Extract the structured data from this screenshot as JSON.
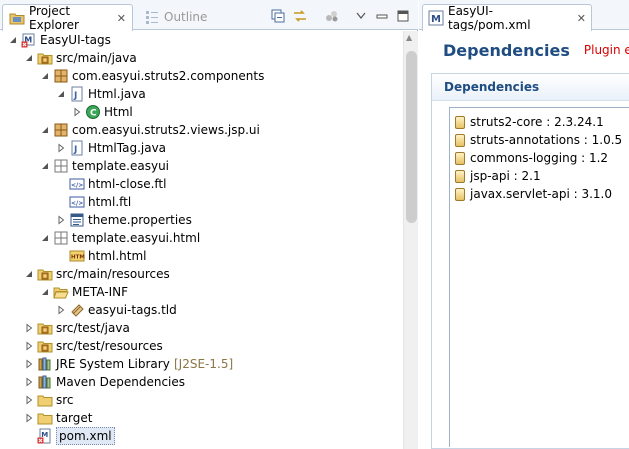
{
  "left_view": {
    "tabs": [
      {
        "label": "Project Explorer",
        "active": true,
        "close": "✕"
      },
      {
        "label": "Outline",
        "active": false
      }
    ],
    "tree": [
      {
        "label": "EasyUI-tags",
        "icon": "maven-project-error-icon",
        "twisty": "open",
        "depth": 0
      },
      {
        "label": "src/main/java",
        "icon": "source-folder-icon",
        "twisty": "open",
        "depth": 1
      },
      {
        "label": "com.easyui.struts2.components",
        "icon": "package-icon",
        "twisty": "open",
        "depth": 2
      },
      {
        "label": "Html.java",
        "icon": "java-file-icon",
        "twisty": "open",
        "depth": 3
      },
      {
        "label": "Html",
        "icon": "java-class-icon",
        "twisty": "closed",
        "depth": 4
      },
      {
        "label": "com.easyui.struts2.views.jsp.ui",
        "icon": "package-icon",
        "twisty": "open",
        "depth": 2
      },
      {
        "label": "HtmlTag.java",
        "icon": "java-file-icon",
        "twisty": "closed",
        "depth": 3
      },
      {
        "label": "template.easyui",
        "icon": "empty-package-icon",
        "twisty": "open",
        "depth": 2
      },
      {
        "label": "html-close.ftl",
        "icon": "ftl-file-icon",
        "twisty": "none",
        "depth": 3
      },
      {
        "label": "html.ftl",
        "icon": "ftl-file-icon",
        "twisty": "none",
        "depth": 3
      },
      {
        "label": "theme.properties",
        "icon": "properties-file-icon",
        "twisty": "closed",
        "depth": 3
      },
      {
        "label": "template.easyui.html",
        "icon": "empty-package-icon",
        "twisty": "open",
        "depth": 2
      },
      {
        "label": "html.html",
        "icon": "html-file-icon",
        "twisty": "none",
        "depth": 3
      },
      {
        "label": "src/main/resources",
        "icon": "source-folder-icon",
        "twisty": "open",
        "depth": 1
      },
      {
        "label": "META-INF",
        "icon": "folder-open-icon",
        "twisty": "open",
        "depth": 2
      },
      {
        "label": "easyui-tags.tld",
        "icon": "tld-file-icon",
        "twisty": "closed",
        "depth": 3
      },
      {
        "label": "src/test/java",
        "icon": "source-folder-icon",
        "twisty": "closed",
        "depth": 1
      },
      {
        "label": "src/test/resources",
        "icon": "source-folder-icon",
        "twisty": "closed",
        "depth": 1
      },
      {
        "label": "JRE System Library",
        "decoration": "[J2SE-1.5]",
        "icon": "library-icon",
        "twisty": "closed",
        "depth": 1
      },
      {
        "label": "Maven Dependencies",
        "icon": "library-icon",
        "twisty": "closed",
        "depth": 1
      },
      {
        "label": "src",
        "icon": "folder-icon",
        "twisty": "closed",
        "depth": 1
      },
      {
        "label": "target",
        "icon": "folder-icon",
        "twisty": "closed",
        "depth": 1
      },
      {
        "label": "pom.xml",
        "icon": "maven-pom-error-icon",
        "twisty": "none",
        "depth": 1,
        "selected": true
      }
    ]
  },
  "editor": {
    "tab_label": "EasyUI-tags/pom.xml",
    "tab_close": "✕",
    "title": "Dependencies",
    "error_text": "Plugin ex",
    "section_title": "Dependencies",
    "dependencies": [
      "struts2-core : 2.3.24.1",
      "struts-annotations : 1.0.5",
      "commons-logging : 1.2",
      "jsp-api : 2.1",
      "javax.servlet-api : 3.1.0"
    ]
  },
  "colors": {
    "accent": "#1f4d82",
    "error": "#d80000",
    "decoration": "#8d7648",
    "selection": "#dfe8f4"
  }
}
